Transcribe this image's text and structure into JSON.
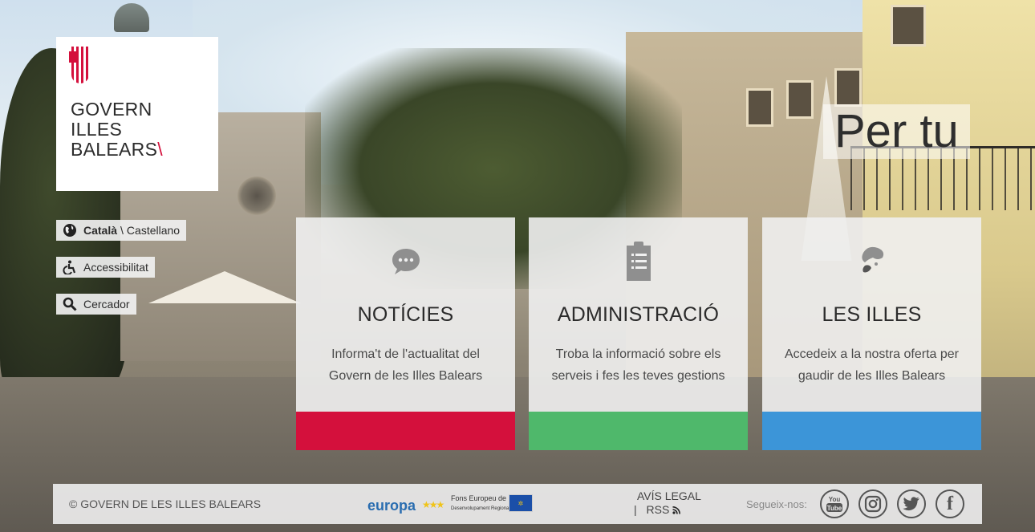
{
  "logo": {
    "line1": "GOVERN",
    "line2": "ILLES",
    "line3": "BALEARS",
    "accent": "\\",
    "brand_color": "#d4103c"
  },
  "tools": {
    "language": {
      "icon": "globe-icon",
      "selected": "Català",
      "separator": "\\",
      "other": "Castellano"
    },
    "accessibility": {
      "icon": "wheelchair-icon",
      "label": "Accessibilitat"
    },
    "search": {
      "icon": "search-icon",
      "label": "Cercador"
    }
  },
  "hero": {
    "tagline": "Per tu"
  },
  "cards": [
    {
      "icon": "chat-bubble-icon",
      "title": "NOTÍCIES",
      "text": "Informa't de l'actualitat del Govern de les Illes Balears",
      "color": "#d4103c"
    },
    {
      "icon": "clipboard-icon",
      "title": "ADMINISTRACIÓ",
      "text": "Troba la informació sobre els serveis i fes les teves gestions",
      "color": "#4fb86b"
    },
    {
      "icon": "island-icon",
      "title": "LES ILLES",
      "text": "Accedeix a la nostra oferta per gaudir de les Illes Balears",
      "color": "#3c95d8"
    }
  ],
  "footer": {
    "copyright": "© GOVERN DE LES ILLES BALEARS",
    "eu_logo": {
      "word": "europa",
      "fons": "Fons Europeu de",
      "fons_sub": "Desenvolupament Regional"
    },
    "legal": "AVÍS LEGAL",
    "rss_separator": "|",
    "rss": "RSS",
    "follow": "Segueix-nos:",
    "social": [
      {
        "icon": "youtube-icon",
        "label": "You Tube"
      },
      {
        "icon": "instagram-icon",
        "label": ""
      },
      {
        "icon": "twitter-icon",
        "label": ""
      },
      {
        "icon": "facebook-icon",
        "label": "f"
      }
    ]
  }
}
